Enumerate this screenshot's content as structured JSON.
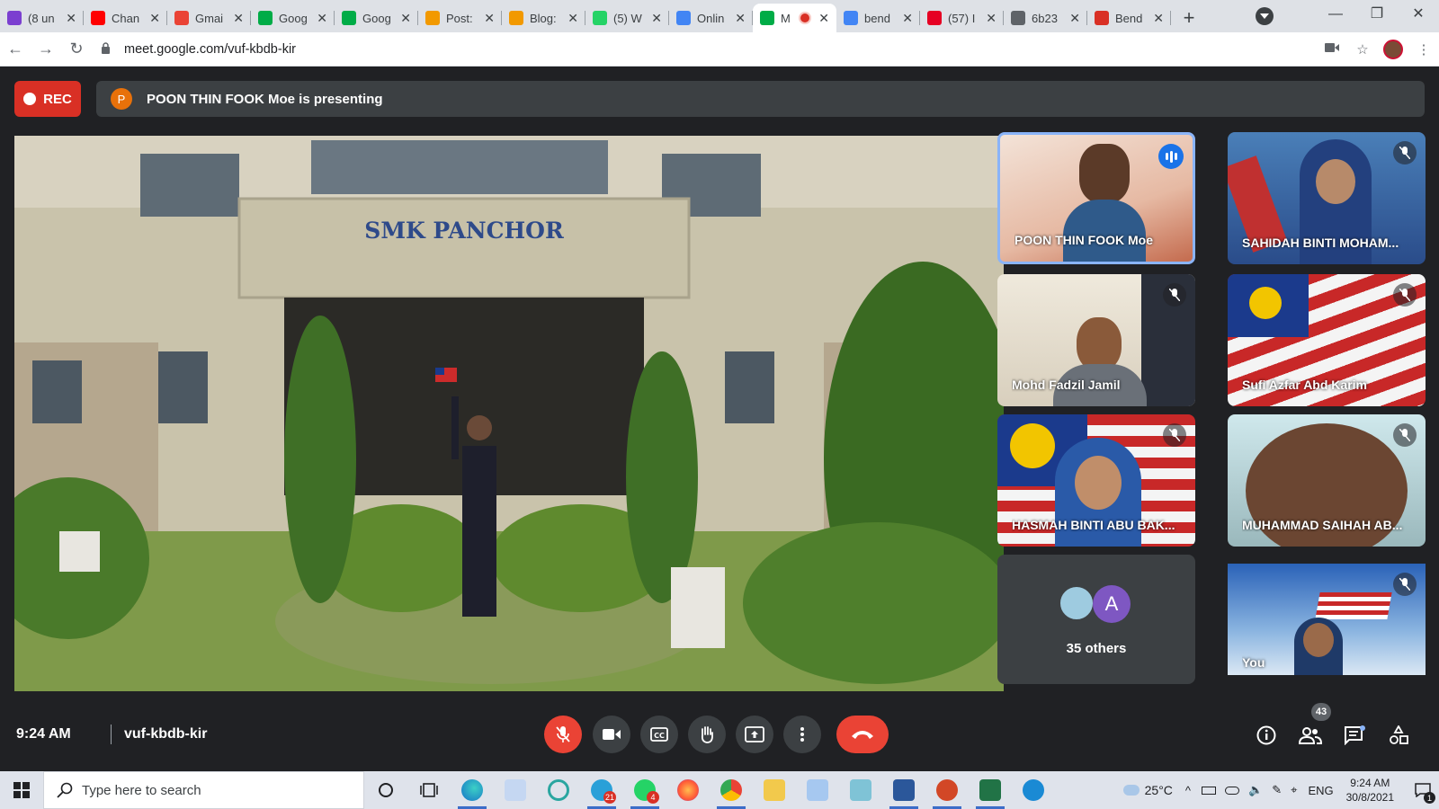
{
  "browser": {
    "tabs": [
      {
        "label": "(8 un",
        "color": "#7b3fd0"
      },
      {
        "label": "Chan",
        "color": "#ff0000"
      },
      {
        "label": "Gmai",
        "color": "#ea4335"
      },
      {
        "label": "Goog",
        "color": "#00ac47"
      },
      {
        "label": "Goog",
        "color": "#00ac47"
      },
      {
        "label": "Post:",
        "color": "#f29900"
      },
      {
        "label": "Blog:",
        "color": "#f29900"
      },
      {
        "label": "(5) W",
        "color": "#25d366"
      },
      {
        "label": "Onlin",
        "color": "#4285f4"
      },
      {
        "label": "M",
        "color": "#00ac47",
        "active": true,
        "recording": true
      },
      {
        "label": "bend",
        "color": "#4285f4"
      },
      {
        "label": "(57) I",
        "color": "#e60023"
      },
      {
        "label": "6b23",
        "color": "#5f6368"
      },
      {
        "label": "Bend",
        "color": "#d93025"
      }
    ],
    "new_tab_label": "+",
    "url": "meet.google.com/vuf-kbdb-kir"
  },
  "meet": {
    "rec_label": "REC",
    "presenter_initial": "P",
    "presenting_text": "POON THIN FOOK Moe is presenting",
    "stage_sign": "SMK PANCHOR",
    "participants": [
      {
        "name": "POON THIN FOOK Moe",
        "speaking": true
      },
      {
        "name": "SAHIDAH BINTI MOHAM...",
        "muted": true
      },
      {
        "name": "Mohd Fadzil Jamil",
        "muted": true
      },
      {
        "name": "Sufi Azfar Abd Karim",
        "muted": true
      },
      {
        "name": "HASMAH BINTI ABU BAK...",
        "muted": true
      },
      {
        "name": "MUHAMMAD SAIHAH AB...",
        "muted": true
      },
      {
        "name": "You",
        "muted": true
      }
    ],
    "others_label": "35 others",
    "others_avatar_letter": "A",
    "time": "9:24 AM",
    "meeting_code": "vuf-kbdb-kir",
    "people_count": "43"
  },
  "taskbar": {
    "search_placeholder": "Type here to search",
    "telegram_badge": "21",
    "whatsapp_badge": "4",
    "temperature": "25°C",
    "language": "ENG",
    "clock_time": "9:24 AM",
    "clock_date": "30/8/2021",
    "notification_count": "1"
  },
  "colors": {
    "meet_bg": "#202124",
    "rec_red": "#d93025",
    "hangup_red": "#ea4335",
    "speaking_blue": "#1a73e8"
  }
}
